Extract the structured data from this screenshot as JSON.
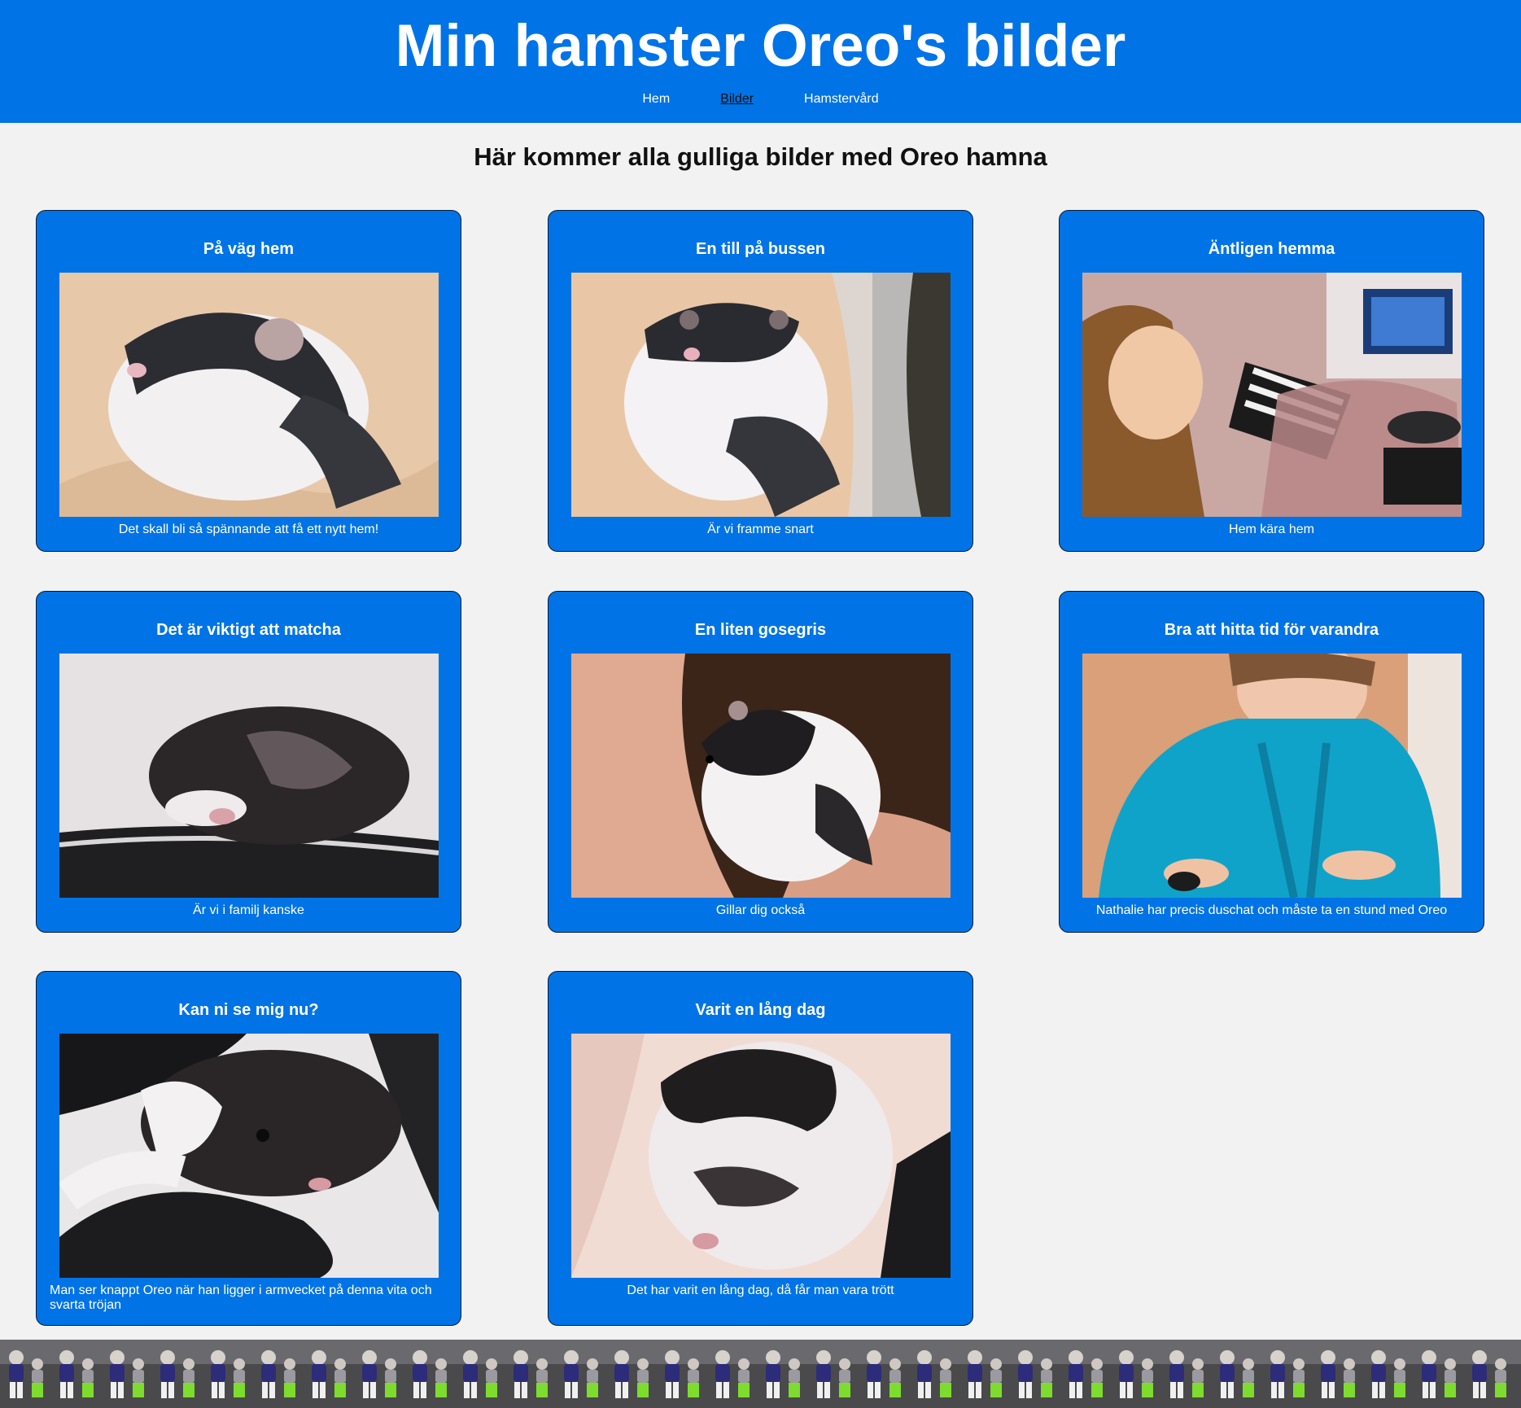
{
  "header": {
    "title": "Min hamster Oreo's bilder",
    "nav": [
      {
        "label": "Hem",
        "active": false
      },
      {
        "label": "Bilder",
        "active": true
      },
      {
        "label": "Hamstervård",
        "active": false
      }
    ]
  },
  "main": {
    "heading": "Här kommer alla gulliga bilder med Oreo hamna",
    "cards": [
      {
        "title": "På väg hem",
        "caption": "Det skall bli så spännande att få ett nytt hem!"
      },
      {
        "title": "En till på bussen",
        "caption": "Är vi framme snart"
      },
      {
        "title": "Äntligen hemma",
        "caption": "Hem kära hem"
      },
      {
        "title": "Det är viktigt att matcha",
        "caption": "Är vi i familj kanske"
      },
      {
        "title": "En liten gosegris",
        "caption": "Gillar dig också"
      },
      {
        "title": "Bra att hitta tid för varandra",
        "caption": "Nathalie har precis duschat och måste ta en stund med Oreo"
      },
      {
        "title": "Kan ni se mig nu?",
        "caption": "Man ser knappt Oreo när han ligger i armvecket på denna vita och svarta tröjan"
      },
      {
        "title": "Varit en lång dag",
        "caption": "Det har varit en lång dag, då får man vara trött"
      }
    ]
  },
  "colors": {
    "brand_blue": "#0073e6",
    "page_bg": "#f2f2f2"
  }
}
